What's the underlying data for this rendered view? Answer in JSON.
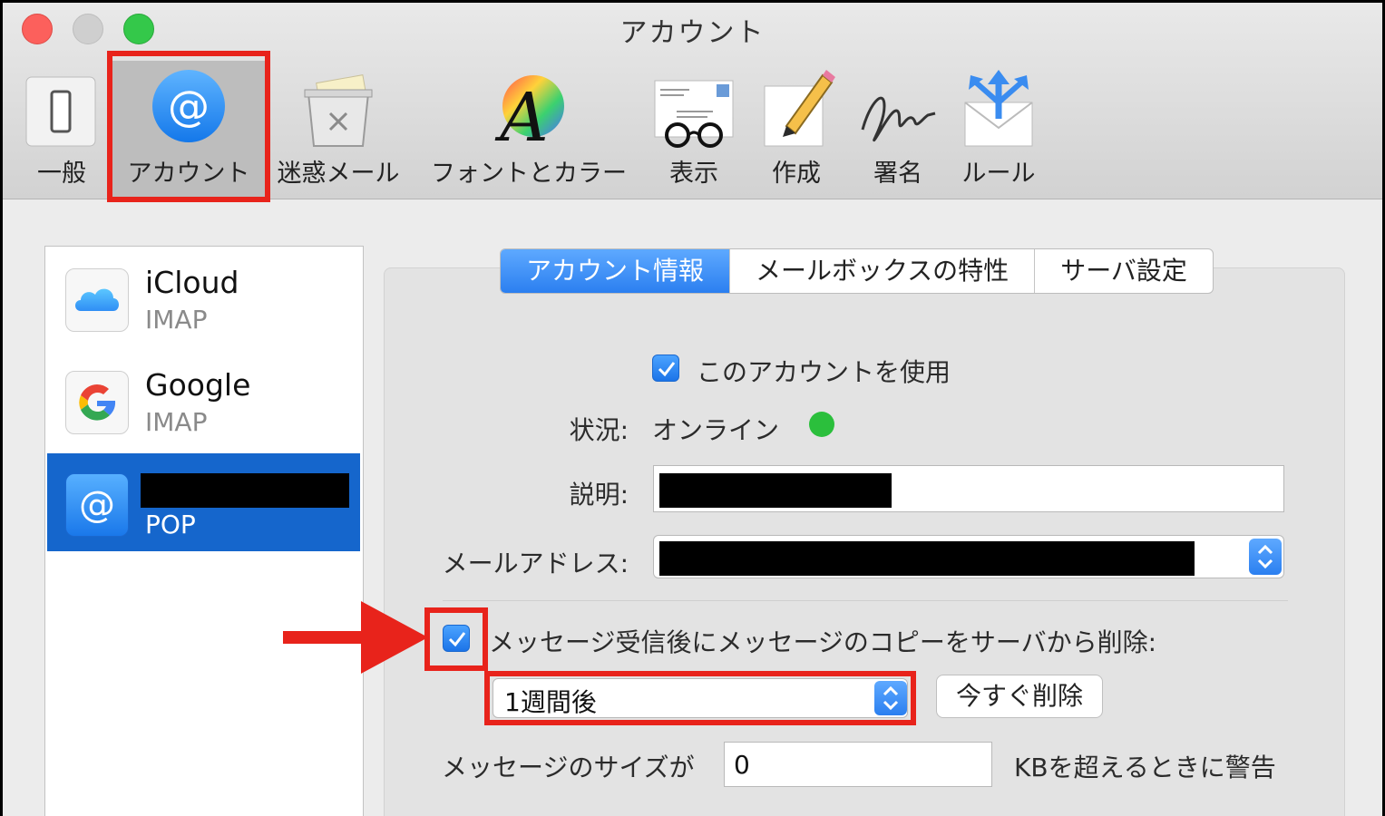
{
  "window": {
    "title": "アカウント"
  },
  "toolbar": {
    "items": [
      {
        "label": "一般",
        "icon": "general-switch-icon"
      },
      {
        "label": "アカウント",
        "icon": "at-sign-icon"
      },
      {
        "label": "迷惑メール",
        "icon": "junk-trash-icon"
      },
      {
        "label": "フォントとカラー",
        "icon": "font-color-icon"
      },
      {
        "label": "表示",
        "icon": "glasses-letter-icon"
      },
      {
        "label": "作成",
        "icon": "pencil-paper-icon"
      },
      {
        "label": "署名",
        "icon": "signature-icon"
      },
      {
        "label": "ルール",
        "icon": "rules-envelope-icon"
      }
    ]
  },
  "accounts": [
    {
      "name": "iCloud",
      "type": "IMAP",
      "icon": "icloud-icon"
    },
    {
      "name": "Google",
      "type": "IMAP",
      "icon": "google-icon"
    },
    {
      "name": "",
      "type": "POP",
      "icon": "at-sign-icon",
      "selected": true
    }
  ],
  "tabs": [
    "アカウント情報",
    "メールボックスの特性",
    "サーバ設定"
  ],
  "form": {
    "enable_label": "このアカウントを使用",
    "status_label": "状況:",
    "status_value": "オンライン",
    "status_color": "#2bbf3c",
    "description_label": "説明:",
    "email_label": "メールアドレス:",
    "delete_copy_label": "メッセージ受信後にメッセージのコピーをサーバから削除:",
    "delete_period": "1週間後",
    "delete_now_button": "今すぐ削除",
    "size_label": "メッセージのサイズが",
    "size_value": "0",
    "size_suffix": "KBを超えるときに警告"
  },
  "colors": {
    "accent": "#2b7ff0",
    "highlight_box": "#e8231b",
    "selection": "#1566cc"
  }
}
